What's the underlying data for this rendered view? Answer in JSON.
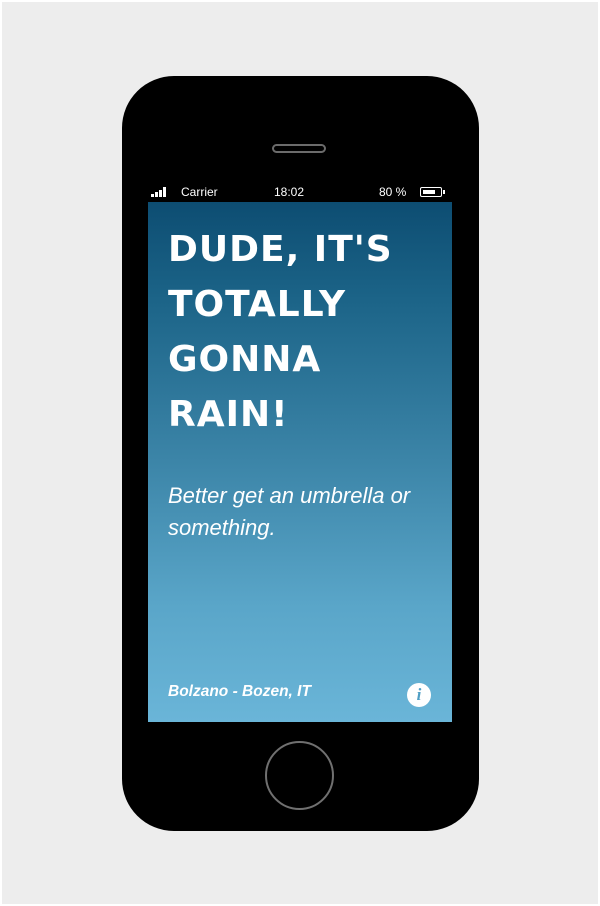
{
  "status_bar": {
    "carrier": "Carrier",
    "time": "18:02",
    "battery_text": "80 %",
    "battery_level": 0.8,
    "signal_icon": "signal-bars-icon",
    "battery_icon": "battery-icon"
  },
  "forecast": {
    "headline": "DUDE, IT'S TOTALLY GONNA RAIN!",
    "subline": "Better get an umbrella or something."
  },
  "footer": {
    "location": "Bolzano - Bozen, IT",
    "info_label": "i",
    "info_icon": "info-icon"
  },
  "colors": {
    "gradient_top": "#0d4d72",
    "gradient_bottom": "#6ab5d8",
    "device_body": "#000000",
    "backdrop": "#ededed",
    "text": "#ffffff"
  }
}
